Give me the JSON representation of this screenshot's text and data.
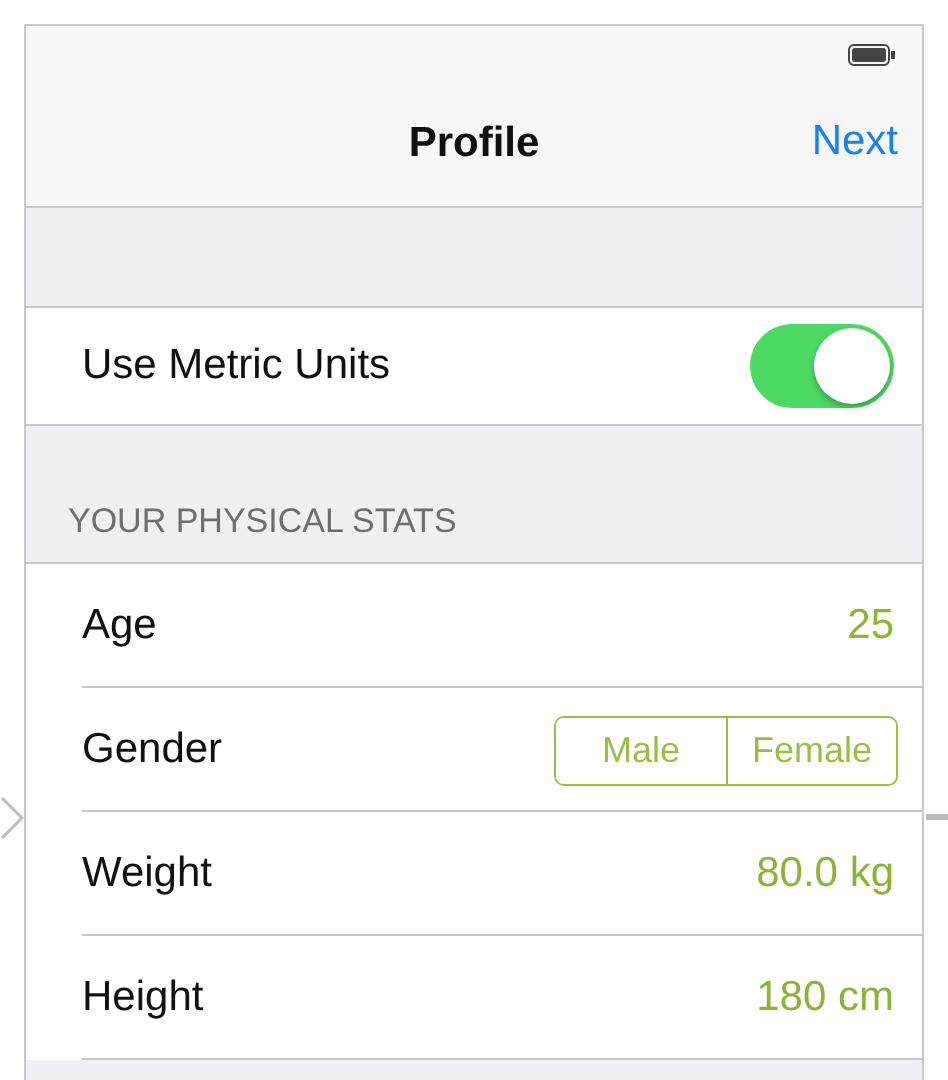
{
  "nav_bar": {
    "title": "Profile",
    "action": "Next"
  },
  "settings": {
    "label": "Use Metric Units",
    "on": true
  },
  "section": {
    "header": "YOUR PHYSICAL STATS",
    "rows": [
      {
        "kind": "value",
        "label": "Age",
        "value": "25"
      },
      {
        "kind": "segmented",
        "label": "Gender",
        "segments": [
          {
            "label": "Male",
            "selected": false
          },
          {
            "label": "Female",
            "selected": false
          }
        ]
      },
      {
        "kind": "value",
        "label": "Weight",
        "value": "80.0 kg"
      },
      {
        "kind": "value",
        "label": "Height",
        "value": "180 cm"
      }
    ]
  }
}
